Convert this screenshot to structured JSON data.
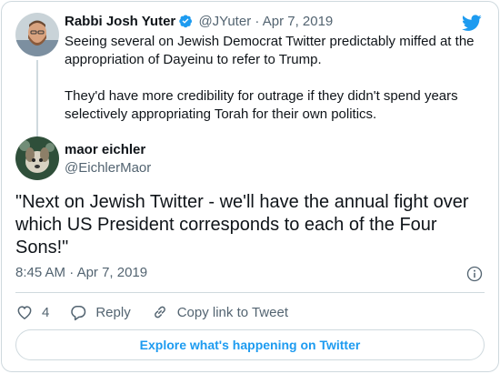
{
  "parent_tweet": {
    "display_name": "Rabbi Josh Yuter",
    "handle": "@JYuter",
    "separator": "·",
    "date": "Apr 7, 2019",
    "verified": true,
    "avatar_icon": "bearded-man-avatar",
    "paragraphs": [
      "Seeing several on Jewish Democrat Twitter predictably miffed at the appropriation of Dayeinu to refer to Trump.",
      "They'd have more credibility for outrage if they didn't spend years selectively appropriating Torah for their own politics."
    ]
  },
  "main_tweet": {
    "display_name": "maor eichler",
    "handle": "@EichlerMaor",
    "avatar_icon": "dog-photo-avatar",
    "text": "\"Next on Jewish Twitter - we'll have the annual fight over which US President corresponds to each of the Four Sons!\"",
    "time": "8:45 AM",
    "separator": "·",
    "date": "Apr 7, 2019"
  },
  "actions": {
    "like_count": "4",
    "reply_label": "Reply",
    "copy_link_label": "Copy link to Tweet"
  },
  "explore_label": "Explore what's happening on Twitter",
  "colors": {
    "brand_blue": "#1d9bf0",
    "text_primary": "#0f1419",
    "text_secondary": "#536471",
    "border": "#cfd9de"
  }
}
